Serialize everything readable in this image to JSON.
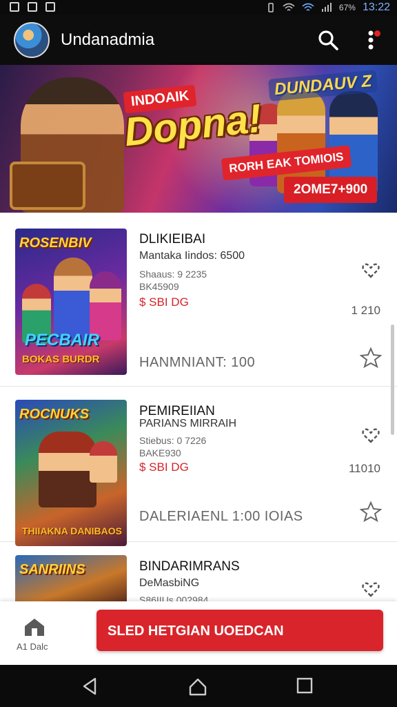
{
  "status_bar": {
    "time": "13:22",
    "battery": "67%"
  },
  "app_bar": {
    "title": "Undanadmia"
  },
  "banner": {
    "tag_top": "INDOAIK",
    "headline": "Dopna!",
    "brand": "DUNDAUV Z",
    "tag_bottom": "RORH EAK TOMIOIS",
    "price": "2OME7+900"
  },
  "cards": [
    {
      "title": "DLIKIEIBAI",
      "subtitle": "Mantaka Iindos: 6500",
      "meta1": "Shaaus: 9 2235",
      "meta2": "BK45909",
      "price": "$ SBI DG",
      "count": "1 210",
      "footer": "HANMNIANT: 100",
      "thumb_title": "ROSENBIV",
      "thumb_sub1": "PECBAIR",
      "thumb_sub2": "BOKAS BURDR"
    },
    {
      "title": "PEMIREIIAN",
      "subtitle": "PARIANS MIRRAIH",
      "meta1": "Stiebus: 0 7226",
      "meta2": "BAKE930",
      "price": "$ SBI DG",
      "count": "11010",
      "footer": "DALERIAENL 1:00 IOIAS",
      "thumb_title": "ROCNUKS",
      "thumb_sub1": "",
      "thumb_sub2": "THIIAKNA DANIBAOS"
    },
    {
      "title": "BINDARIMRANS",
      "subtitle": "DeMasbiNG",
      "meta1": "S86IIUs 002984",
      "thumb_title": "SANRIINS"
    }
  ],
  "action_bar": {
    "home_label": "A1 Dalc",
    "cta_label": "SLED HETGIAN UOEDCAN"
  },
  "colors": {
    "accent": "#d9242b",
    "app_bar": "#0d0d0d",
    "price": "#d7232a"
  }
}
